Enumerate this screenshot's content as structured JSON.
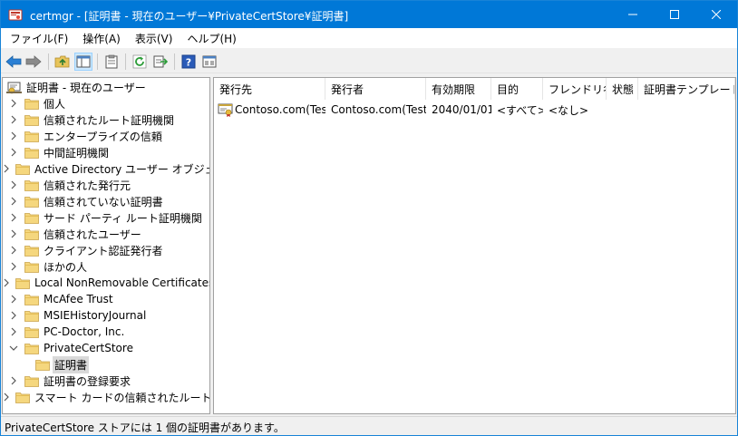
{
  "window": {
    "title": "certmgr - [証明書 - 現在のユーザー¥PrivateCertStore¥証明書]",
    "accent": "#0078d7"
  },
  "menu": [
    {
      "label": "ファイル(F)"
    },
    {
      "label": "操作(A)"
    },
    {
      "label": "表示(V)"
    },
    {
      "label": "ヘルプ(H)"
    }
  ],
  "toolbar": {
    "icons": [
      "back-arrow-icon",
      "forward-arrow-icon",
      "up-folder-icon",
      "show-hide-tree-icon",
      "clipboard-icon",
      "refresh-icon",
      "export-list-icon",
      "help-icon",
      "mmc-icon"
    ]
  },
  "tree": {
    "root": "証明書 - 現在のユーザー",
    "items": [
      {
        "label": "個人"
      },
      {
        "label": "信頼されたルート証明機関"
      },
      {
        "label": "エンタープライズの信頼"
      },
      {
        "label": "中間証明機関"
      },
      {
        "label": "Active Directory ユーザー オブジェクト"
      },
      {
        "label": "信頼された発行元"
      },
      {
        "label": "信頼されていない証明書"
      },
      {
        "label": "サード パーティ ルート証明機関"
      },
      {
        "label": "信頼されたユーザー"
      },
      {
        "label": "クライアント認証発行者"
      },
      {
        "label": "ほかの人"
      },
      {
        "label": "Local NonRemovable Certificates"
      },
      {
        "label": "McAfee Trust"
      },
      {
        "label": "MSIEHistoryJournal"
      },
      {
        "label": "PC-Doctor, Inc."
      },
      {
        "label": "PrivateCertStore",
        "expanded": true
      },
      {
        "label": "証明書",
        "child": true,
        "selected": true
      },
      {
        "label": "証明書の登録要求"
      },
      {
        "label": "スマート カードの信頼されたルート"
      }
    ]
  },
  "list": {
    "columns": [
      "発行先",
      "発行者",
      "有効期限",
      "目的",
      "フレンドリ名",
      "状態",
      "証明書テンプレート"
    ],
    "rows": [
      [
        "Contoso.com(Test)",
        "Contoso.com(Test)",
        "2040/01/01",
        "<すべて>",
        "<なし>",
        "",
        ""
      ]
    ]
  },
  "status": {
    "text": "PrivateCertStore ストアには 1 個の証明書があります。"
  }
}
